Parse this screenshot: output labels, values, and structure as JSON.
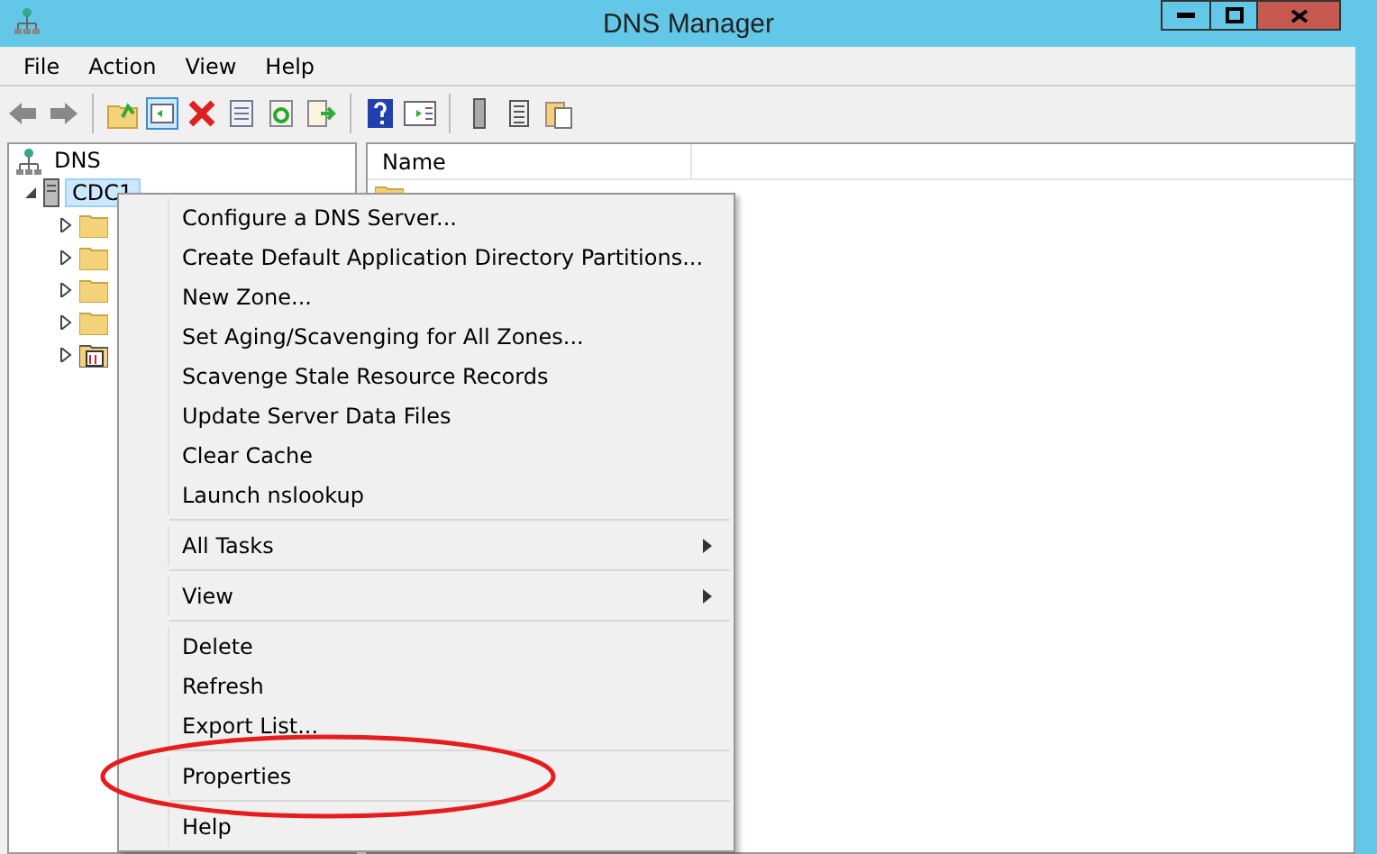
{
  "window": {
    "title": "DNS Manager"
  },
  "menu_bar": [
    "File",
    "Action",
    "View",
    "Help"
  ],
  "tree": {
    "label": "DNS",
    "children": [
      {
        "label": "CDC1",
        "expanded": true,
        "selected": true,
        "children": [
          {
            "kind": "folder",
            "expanded": false
          },
          {
            "kind": "folder",
            "expanded": false
          },
          {
            "kind": "folder",
            "expanded": false
          },
          {
            "kind": "folder",
            "expanded": false
          },
          {
            "kind": "log",
            "expanded": false
          }
        ]
      }
    ]
  },
  "list": {
    "columns": [
      "Name"
    ]
  },
  "context_menu": [
    {
      "kind": "item",
      "label": "Configure a DNS Server..."
    },
    {
      "kind": "item",
      "label": "Create Default Application Directory Partitions..."
    },
    {
      "kind": "item",
      "label": "New Zone..."
    },
    {
      "kind": "item",
      "label": "Set Aging/Scavenging for All Zones..."
    },
    {
      "kind": "item",
      "label": "Scavenge Stale Resource Records"
    },
    {
      "kind": "item",
      "label": "Update Server Data Files"
    },
    {
      "kind": "item",
      "label": "Clear Cache"
    },
    {
      "kind": "item",
      "label": "Launch nslookup"
    },
    {
      "kind": "separator"
    },
    {
      "kind": "submenu",
      "label": "All Tasks"
    },
    {
      "kind": "separator"
    },
    {
      "kind": "submenu",
      "label": "View"
    },
    {
      "kind": "separator"
    },
    {
      "kind": "item",
      "label": "Delete"
    },
    {
      "kind": "item",
      "label": "Refresh"
    },
    {
      "kind": "item",
      "label": "Export List..."
    },
    {
      "kind": "separator"
    },
    {
      "kind": "item",
      "label": "Properties",
      "highlighted": true
    },
    {
      "kind": "separator"
    },
    {
      "kind": "item",
      "label": "Help"
    }
  ]
}
